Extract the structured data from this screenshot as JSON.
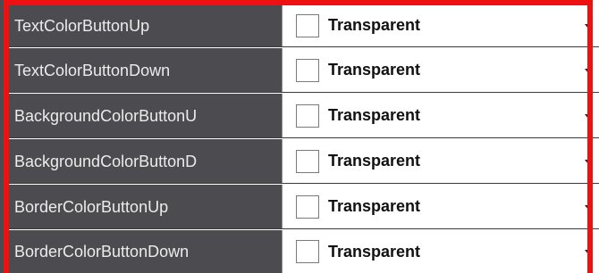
{
  "properties": [
    {
      "name": "TextColorButtonUp",
      "value": "Transparent"
    },
    {
      "name": "TextColorButtonDown",
      "value": "Transparent"
    },
    {
      "name": "BackgroundColorButtonU",
      "value": "Transparent"
    },
    {
      "name": "BackgroundColorButtonD",
      "value": "Transparent"
    },
    {
      "name": "BorderColorButtonUp",
      "value": "Transparent"
    },
    {
      "name": "BorderColorButtonDown",
      "value": "Transparent"
    }
  ],
  "colors": {
    "highlight": "#ee1111",
    "name_cell_bg": "#4b4b50",
    "name_text": "#ececec"
  }
}
